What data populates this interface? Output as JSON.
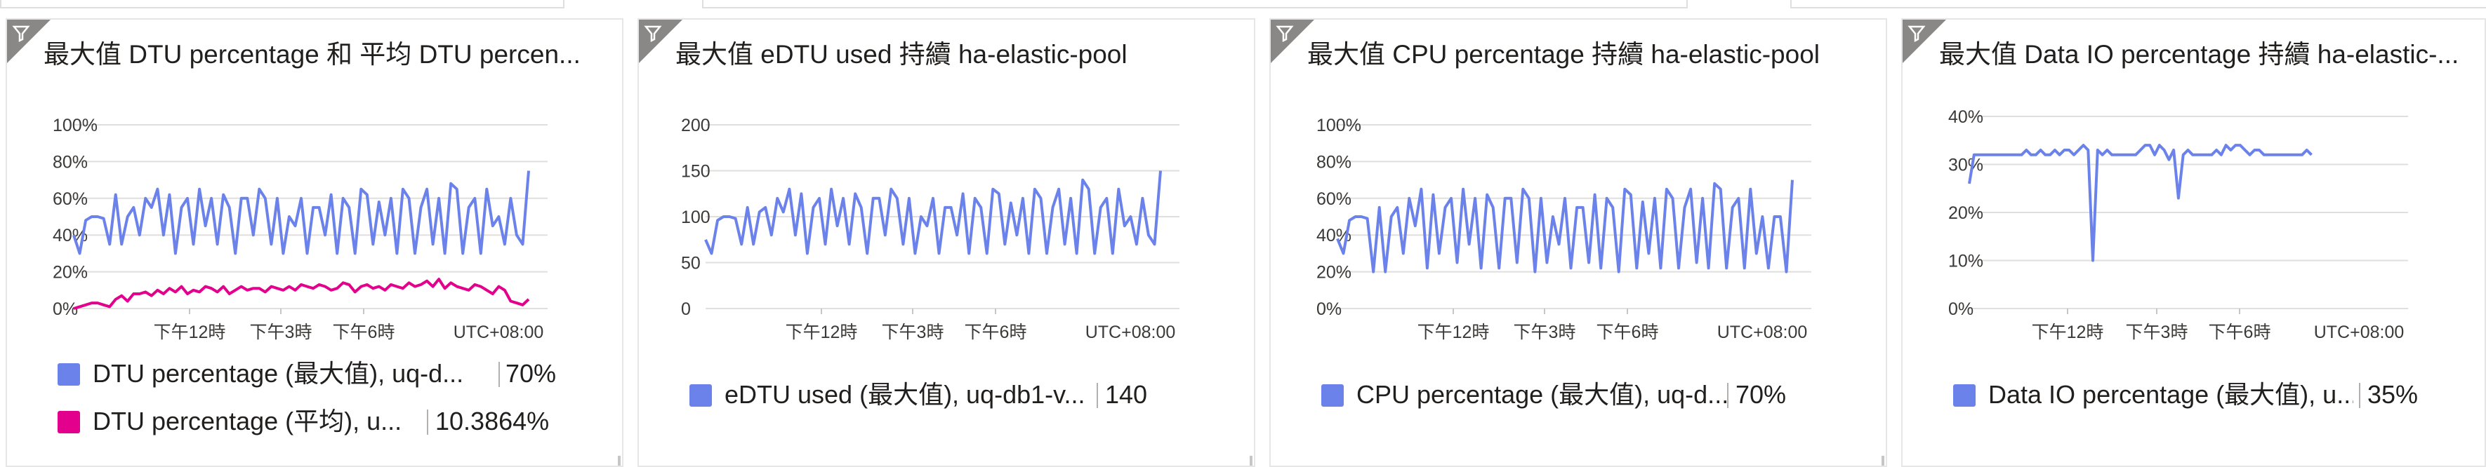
{
  "tiles": [
    {
      "title": "最大值 DTU percentage 和 平均 DTU percen...",
      "legend": [
        {
          "label": "DTU percentage (最大值), uq-d...",
          "value": "70%",
          "color": "#6b82ea"
        },
        {
          "label": "DTU percentage (平均), u...",
          "value": "10.3864%",
          "color": "#e3008c"
        }
      ]
    },
    {
      "title": "最大值 eDTU used 持續 ha-elastic-pool",
      "legend": [
        {
          "label": "eDTU used (最大值), uq-db1-v...",
          "value": "140",
          "color": "#6b82ea"
        }
      ]
    },
    {
      "title": "最大值 CPU percentage 持續 ha-elastic-pool",
      "legend": [
        {
          "label": "CPU percentage (最大值), uq-d...",
          "value": "70%",
          "color": "#6b82ea"
        }
      ]
    },
    {
      "title": "最大值 Data IO percentage 持續 ha-elastic-...",
      "legend": [
        {
          "label": "Data IO percentage (最大值), u...",
          "value": "35%",
          "color": "#6b82ea"
        }
      ]
    }
  ],
  "chart_data": [
    {
      "type": "line",
      "y_ticks": [
        "100%",
        "80%",
        "60%",
        "40%",
        "20%",
        "0%"
      ],
      "x_ticks": [
        "下午12時",
        "下午3時",
        "下午6時"
      ],
      "timezone": "UTC+08:00",
      "ylim": [
        0,
        100
      ],
      "grid": true,
      "series": [
        {
          "name": "DTU percentage (最大值), uq-d...",
          "color": "#6b82ea",
          "values": [
            40,
            30,
            48,
            50,
            50,
            49,
            35,
            62,
            35,
            50,
            55,
            40,
            60,
            55,
            65,
            40,
            62,
            30,
            55,
            60,
            35,
            65,
            45,
            60,
            35,
            62,
            55,
            30,
            60,
            60,
            40,
            65,
            60,
            35,
            60,
            30,
            50,
            45,
            60,
            30,
            55,
            55,
            40,
            62,
            30,
            60,
            55,
            30,
            65,
            62,
            35,
            58,
            40,
            60,
            30,
            65,
            60,
            30,
            55,
            65,
            35,
            60,
            30,
            68,
            65,
            30,
            55,
            60,
            30,
            65,
            45,
            50,
            35,
            60,
            40,
            35,
            75
          ]
        },
        {
          "name": "DTU percentage (平均), u...",
          "color": "#e3008c",
          "values": [
            0,
            1,
            2,
            3,
            3,
            2,
            1,
            5,
            7,
            4,
            8,
            8,
            9,
            7,
            10,
            8,
            11,
            9,
            12,
            8,
            10,
            9,
            12,
            11,
            9,
            12,
            8,
            10,
            12,
            10,
            11,
            11,
            9,
            12,
            11,
            10,
            12,
            10,
            13,
            12,
            11,
            13,
            12,
            10,
            11,
            14,
            13,
            9,
            12,
            13,
            11,
            12,
            10,
            13,
            12,
            11,
            14,
            12,
            13,
            15,
            12,
            16,
            11,
            14,
            12,
            11,
            10,
            13,
            12,
            10,
            8,
            12,
            10,
            4,
            3,
            2,
            5
          ]
        }
      ]
    },
    {
      "type": "line",
      "y_ticks": [
        "200",
        "150",
        "100",
        "50",
        "0"
      ],
      "x_ticks": [
        "下午12時",
        "下午3時",
        "下午6時"
      ],
      "timezone": "UTC+08:00",
      "ylim": [
        0,
        200
      ],
      "grid": true,
      "series": [
        {
          "name": "eDTU used (最大值), uq-db1-v...",
          "color": "#6b82ea",
          "values": [
            75,
            60,
            96,
            100,
            100,
            98,
            70,
            110,
            70,
            105,
            110,
            80,
            120,
            105,
            130,
            80,
            125,
            60,
            110,
            120,
            70,
            130,
            90,
            120,
            70,
            125,
            110,
            60,
            120,
            120,
            80,
            130,
            120,
            70,
            120,
            60,
            100,
            90,
            120,
            60,
            110,
            110,
            80,
            125,
            60,
            120,
            110,
            60,
            130,
            125,
            70,
            115,
            80,
            120,
            60,
            130,
            120,
            60,
            110,
            130,
            70,
            120,
            60,
            140,
            130,
            60,
            110,
            120,
            60,
            130,
            90,
            100,
            70,
            120,
            80,
            70,
            150
          ]
        }
      ]
    },
    {
      "type": "line",
      "y_ticks": [
        "100%",
        "80%",
        "60%",
        "40%",
        "20%",
        "0%"
      ],
      "x_ticks": [
        "下午12時",
        "下午3時",
        "下午6時"
      ],
      "timezone": "UTC+08:00",
      "ylim": [
        0,
        100
      ],
      "grid": true,
      "series": [
        {
          "name": "CPU percentage (最大值), uq-d...",
          "color": "#6b82ea",
          "values": [
            38,
            30,
            48,
            50,
            50,
            49,
            20,
            55,
            20,
            50,
            55,
            30,
            60,
            45,
            65,
            22,
            62,
            30,
            55,
            60,
            25,
            65,
            35,
            60,
            22,
            62,
            55,
            22,
            60,
            60,
            25,
            65,
            60,
            20,
            60,
            25,
            50,
            35,
            60,
            22,
            55,
            55,
            25,
            62,
            22,
            60,
            55,
            20,
            65,
            62,
            22,
            58,
            30,
            60,
            22,
            65,
            60,
            22,
            55,
            65,
            25,
            60,
            22,
            68,
            65,
            22,
            55,
            60,
            22,
            65,
            30,
            50,
            22,
            50,
            50,
            20,
            70
          ]
        }
      ]
    },
    {
      "type": "line",
      "y_ticks": [
        "40%",
        "30%",
        "20%",
        "10%",
        "0%"
      ],
      "x_ticks": [
        "下午12時",
        "下午3時",
        "下午6時"
      ],
      "timezone": "UTC+08:00",
      "ylim": [
        0,
        40
      ],
      "grid": true,
      "series": [
        {
          "name": "Data IO percentage (最大值), u...",
          "color": "#6b82ea",
          "values": [
            26,
            32,
            32,
            32,
            32,
            32,
            32,
            32,
            32,
            32,
            32,
            32,
            33,
            32,
            32,
            33,
            32,
            32,
            33,
            32,
            33,
            33,
            32,
            33,
            34,
            33,
            10,
            33,
            32,
            33,
            32,
            32,
            32,
            32,
            32,
            32,
            33,
            34,
            34,
            32,
            34,
            33,
            31,
            33,
            23,
            32,
            33,
            32,
            32,
            32,
            32,
            32,
            33,
            32,
            34,
            33,
            34,
            34,
            33,
            32,
            33,
            33,
            32,
            32,
            32,
            32,
            32,
            32,
            32,
            32,
            32,
            33,
            32
          ]
        }
      ]
    }
  ]
}
